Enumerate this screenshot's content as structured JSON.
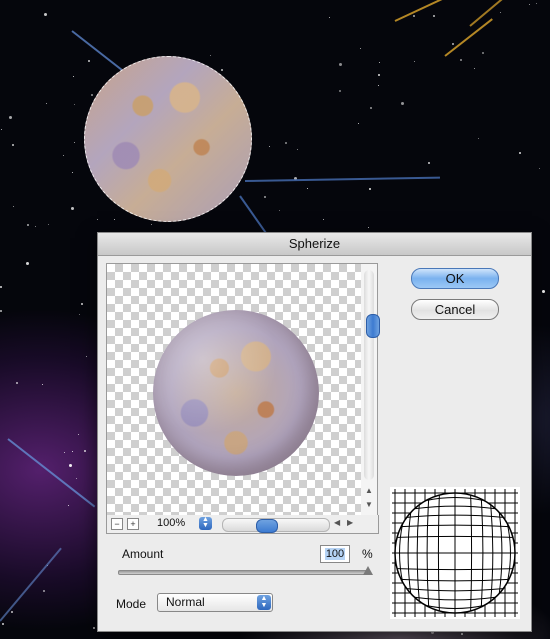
{
  "dialog": {
    "title": "Spherize",
    "ok_label": "OK",
    "cancel_label": "Cancel"
  },
  "preview": {
    "zoom_value": "100%",
    "zoom_out_symbol": "−",
    "zoom_in_symbol": "+"
  },
  "amount": {
    "label": "Amount",
    "value": "100",
    "unit": "%",
    "slider_fraction": 1.0
  },
  "mode": {
    "label": "Mode",
    "value": "Normal"
  },
  "icons": {
    "zoom_out": "minus-icon",
    "zoom_in": "plus-icon",
    "select_arrows": "updown-arrows-icon",
    "grid": "spherize-grid-icon"
  },
  "colors": {
    "accent": "#3d7bd1",
    "dialog_bg": "#ececec"
  }
}
